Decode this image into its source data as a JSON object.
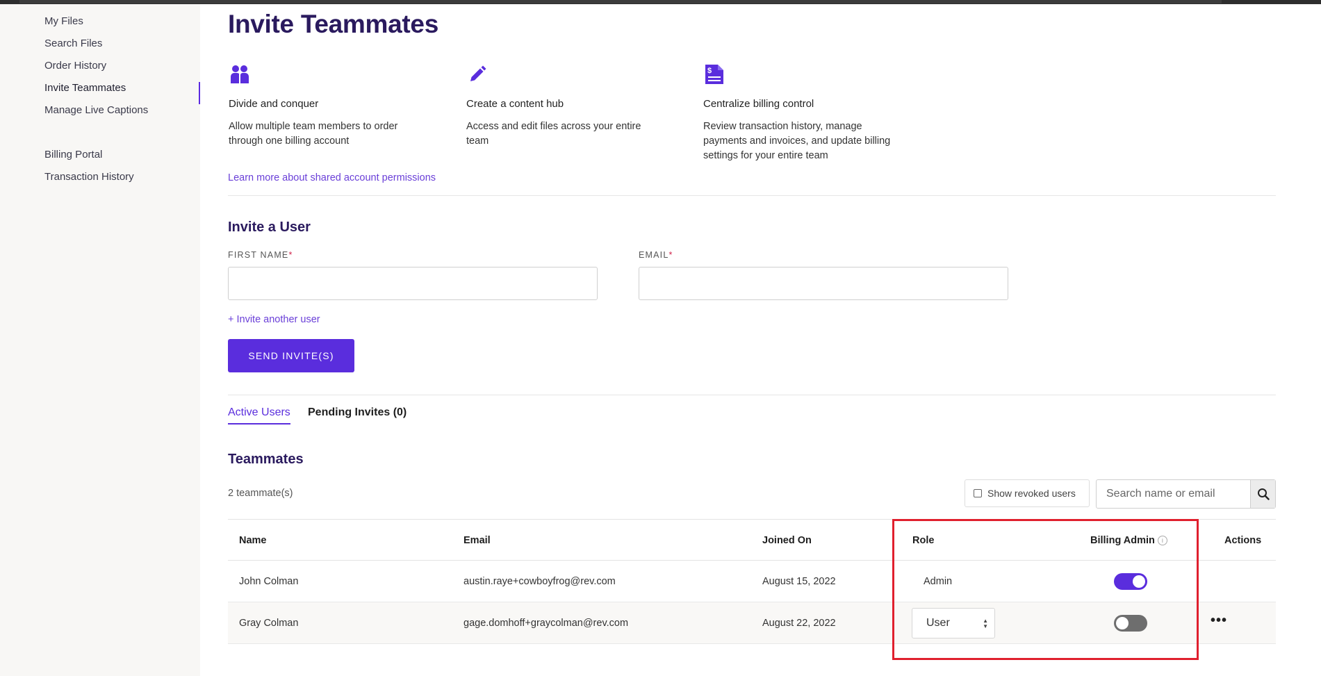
{
  "sidebar": {
    "items": [
      {
        "label": "My Files"
      },
      {
        "label": "Search Files"
      },
      {
        "label": "Order History"
      },
      {
        "label": "Invite Teammates"
      },
      {
        "label": "Manage Live Captions"
      },
      {
        "label": "Billing Portal"
      },
      {
        "label": "Transaction History"
      }
    ],
    "active": "Invite Teammates"
  },
  "page": {
    "title": "Invite Teammates",
    "features": [
      {
        "icon": "people-icon",
        "title": "Divide and conquer",
        "description": "Allow multiple team members to order through one billing account"
      },
      {
        "icon": "pencil-icon",
        "title": "Create a content hub",
        "description": "Access and edit files across your entire team"
      },
      {
        "icon": "billing-document-icon",
        "title": "Centralize billing control",
        "description": "Review transaction history, manage payments and invoices, and update billing settings for your entire team"
      }
    ],
    "learn_more_link": "Learn more about shared account permissions"
  },
  "invite_form": {
    "title": "Invite a User",
    "first_name_label": "FIRST NAME",
    "email_label": "EMAIL",
    "required_marker": "*",
    "first_name_value": "",
    "email_value": "",
    "invite_another_link": "+ Invite another user",
    "send_button": "SEND INVITE(S)"
  },
  "tabs": [
    {
      "label": "Active Users",
      "active": true
    },
    {
      "label": "Pending Invites (0)",
      "active": false
    }
  ],
  "teammates": {
    "title": "Teammates",
    "count_text": "2 teammate(s)",
    "show_revoked_label": "Show revoked users",
    "show_revoked_checked": false,
    "search_placeholder": "Search name or email",
    "search_value": "",
    "columns": [
      "Name",
      "Email",
      "Joined On",
      "Role",
      "Billing Admin",
      "Actions"
    ],
    "billing_admin_info": "i",
    "rows": [
      {
        "name": "John Colman",
        "email": "austin.raye+cowboyfrog@rev.com",
        "joined_on": "August 15, 2022",
        "role": "Admin",
        "role_editable": false,
        "billing_admin": true,
        "actions": ""
      },
      {
        "name": "Gray Colman",
        "email": "gage.domhoff+graycolman@rev.com",
        "joined_on": "August 22, 2022",
        "role": "User",
        "role_editable": true,
        "billing_admin": false,
        "actions": "•••"
      }
    ]
  },
  "colors": {
    "accent": "#5a2ddd",
    "heading": "#2a1a5e",
    "link": "#6a3fd8",
    "highlight_box": "#e0202e",
    "toggle_off": "#6e6e6e"
  }
}
